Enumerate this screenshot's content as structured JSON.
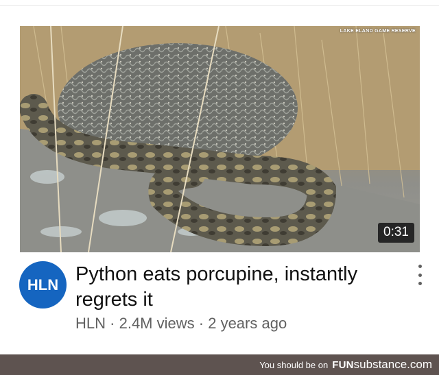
{
  "video": {
    "title": "Python eats porcupine, instantly regrets it",
    "channel_name": "HLN",
    "views": "2.4M views",
    "age": "2 years ago",
    "separator": "·",
    "duration": "0:31",
    "watermark": "LAKE ELAND GAME RESERVE"
  },
  "channel": {
    "avatar_text": "HLN",
    "avatar_color": "#1565c0"
  },
  "footer": {
    "prefix": "You should be on",
    "brand_bold": "FUN",
    "brand_light": "substance.com",
    "bg_color": "#5e5350"
  },
  "icons": {
    "menu": "kebab-menu-icon"
  }
}
